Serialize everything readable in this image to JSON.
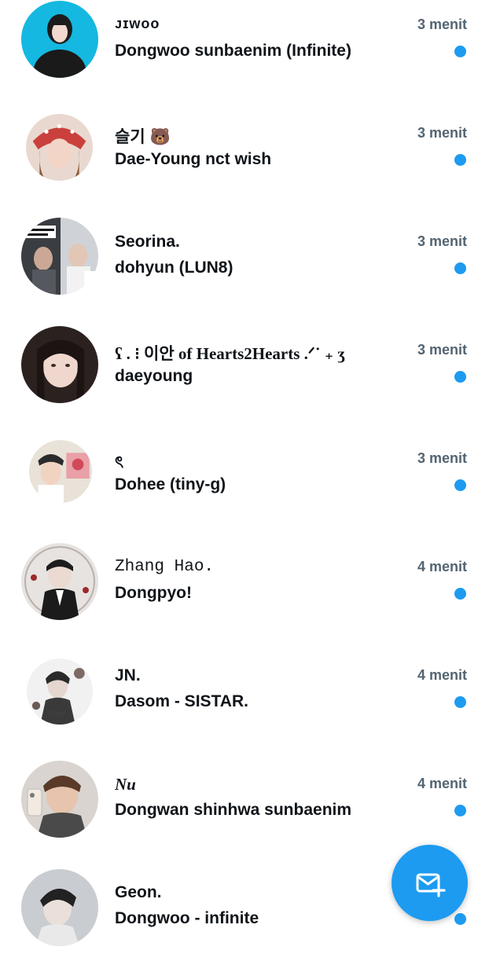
{
  "accent_color": "#1d9bf0",
  "conversations": [
    {
      "name": "ᴊɪᴡᴏᴏ",
      "time": "3 menit",
      "message": "Dongwoo sunbaenim (Infinite)",
      "unread": true
    },
    {
      "name": "슬기 🐻",
      "time": "3 menit",
      "message": "Dae-Young nct wish",
      "unread": true
    },
    {
      "name": "Seorina.",
      "time": "3 menit",
      "message": "dohyun (LUN8)",
      "unread": true
    },
    {
      "name": "ʕ . ⁝ 이안 of Hearts2Hearts .ᐟ˙ ₊ ʒ",
      "time": "3 menit",
      "message": "daeyoung",
      "unread": true
    },
    {
      "name": "ৎ",
      "time": "3 menit",
      "message": "Dohee (tiny-g)",
      "unread": true
    },
    {
      "name": "Zhang Hao.",
      "time": "4 menit",
      "message": "Dongpyo!",
      "unread": true
    },
    {
      "name": "JN.",
      "time": "4 menit",
      "message": "Dasom - SISTAR.",
      "unread": true
    },
    {
      "name": "Nu",
      "time": "4 menit",
      "message": "Dongwan shinhwa sunbaenim",
      "unread": true
    },
    {
      "name": "Geon.",
      "time": "",
      "message": "Dongwoo - infinite",
      "unread": true
    }
  ],
  "fab": {
    "icon": "new-message-icon"
  }
}
